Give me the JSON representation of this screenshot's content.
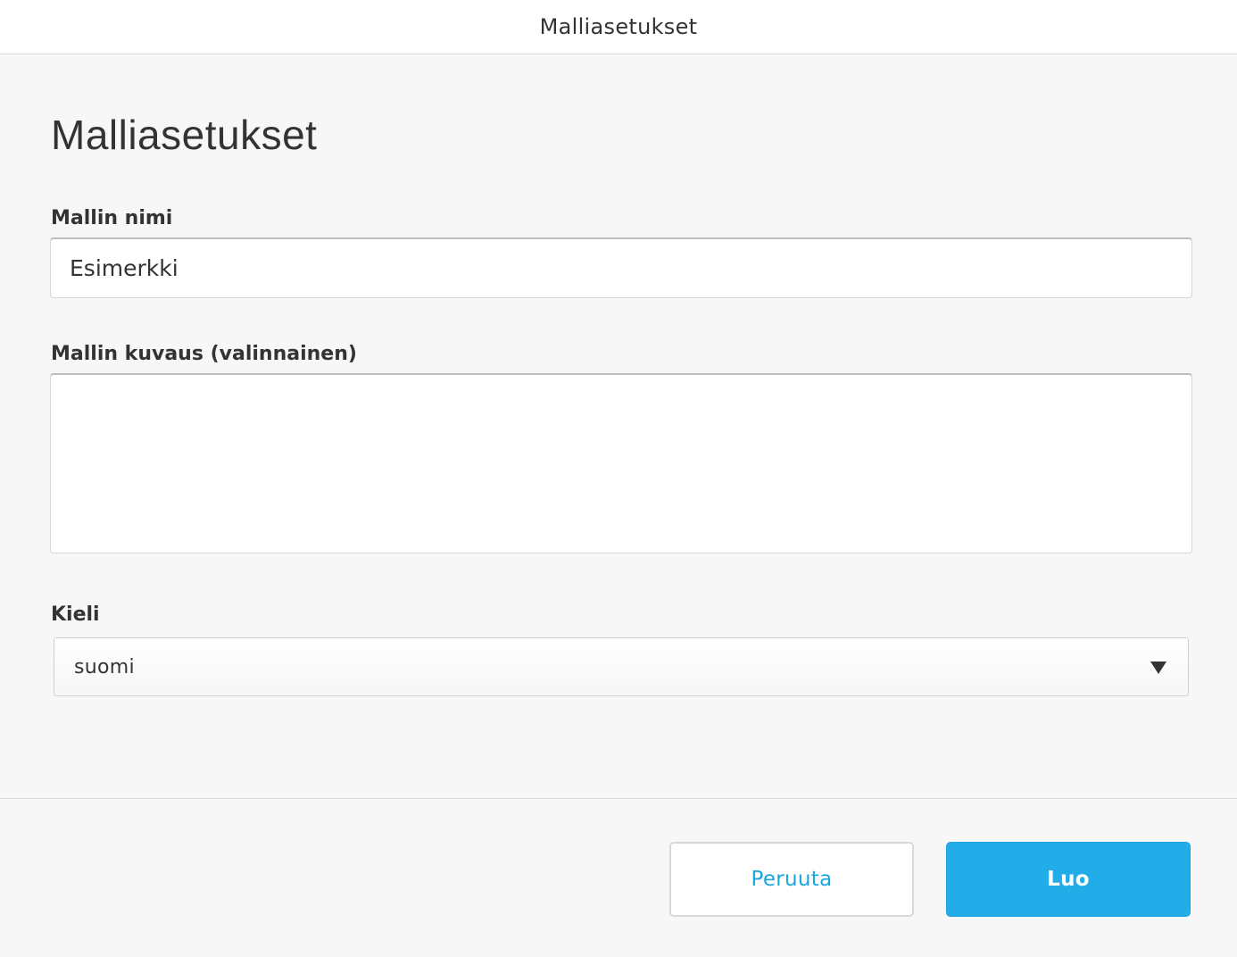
{
  "window": {
    "title": "Malliasetukset"
  },
  "form": {
    "heading": "Malliasetukset",
    "name_label": "Mallin nimi",
    "name_value": "Esimerkki",
    "description_label": "Mallin kuvaus (valinnainen)",
    "description_value": "",
    "language_label": "Kieli",
    "language_value": "suomi"
  },
  "footer": {
    "cancel_label": "Peruuta",
    "create_label": "Luo"
  },
  "colors": {
    "accent": "#22ade8",
    "link_text": "#1aa7dd",
    "background": "#f7f7f7"
  },
  "icons": {
    "select_arrow": "triangle-down-icon"
  }
}
